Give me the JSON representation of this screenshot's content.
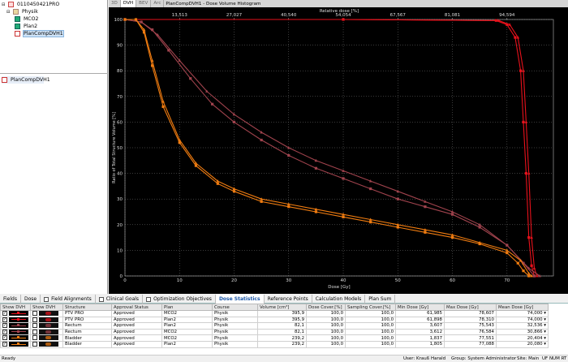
{
  "tree": {
    "patient": "0110450421PRO",
    "course": "Physik",
    "plans": [
      "MCO2",
      "Plan2"
    ],
    "selected": "PlanCompDVH1"
  },
  "plan_list_item": "PlanCompDVH1",
  "chart_tabs": [
    "3D",
    "DVH",
    "BEV",
    "Arc"
  ],
  "chart_title": "PlanCompDVH1 - Dose Volume Histogram",
  "chart_data": {
    "type": "line",
    "title": "",
    "xlabel": "Dose [Gy]",
    "ylabel": "Ratio of Total Structure Volume [%]",
    "x2label": "Relative dose [%]",
    "xlim": [
      0,
      78.5
    ],
    "ylim": [
      0,
      100
    ],
    "xticks": [
      0,
      10,
      20,
      30,
      40,
      50,
      60,
      70
    ],
    "yticks": [
      0,
      10,
      20,
      30,
      40,
      50,
      60,
      70,
      80,
      90,
      100
    ],
    "x2ticks": [
      "13,513",
      "27,027",
      "40,540",
      "54,054",
      "67,567",
      "81,081",
      "94,594"
    ],
    "grid": true,
    "series": [
      {
        "color": "#e8111b",
        "marker": "square",
        "points": [
          [
            0,
            100
          ],
          [
            40,
            100
          ],
          [
            68,
            99.6
          ],
          [
            70,
            98
          ],
          [
            71.5,
            93
          ],
          [
            72.5,
            80
          ],
          [
            73,
            60
          ],
          [
            73.5,
            40
          ],
          [
            74,
            15
          ],
          [
            74.5,
            4
          ],
          [
            75,
            0
          ]
        ]
      },
      {
        "color": "#e8111b",
        "marker": "triangle",
        "points": [
          [
            0,
            100
          ],
          [
            40,
            100
          ],
          [
            68.5,
            99.6
          ],
          [
            70.5,
            98
          ],
          [
            72,
            93
          ],
          [
            73,
            80
          ],
          [
            73.5,
            60
          ],
          [
            74,
            40
          ],
          [
            74.5,
            15
          ],
          [
            75,
            3
          ],
          [
            75.5,
            0
          ]
        ]
      },
      {
        "color": "#a0434d",
        "marker": "square",
        "points": [
          [
            0,
            100
          ],
          [
            3,
            99
          ],
          [
            5,
            96
          ],
          [
            8,
            88
          ],
          [
            12,
            77
          ],
          [
            16,
            67
          ],
          [
            20,
            60
          ],
          [
            25,
            53
          ],
          [
            30,
            47
          ],
          [
            35,
            42
          ],
          [
            40,
            38
          ],
          [
            45,
            34
          ],
          [
            50,
            30
          ],
          [
            55,
            27
          ],
          [
            60,
            24
          ],
          [
            65,
            19
          ],
          [
            70,
            12
          ],
          [
            73,
            5
          ],
          [
            75,
            0
          ]
        ]
      },
      {
        "color": "#a0434d",
        "marker": "triangle",
        "points": [
          [
            0,
            100
          ],
          [
            3,
            99
          ],
          [
            6,
            94
          ],
          [
            10,
            84
          ],
          [
            15,
            72
          ],
          [
            20,
            63
          ],
          [
            25,
            56
          ],
          [
            30,
            50
          ],
          [
            35,
            45
          ],
          [
            40,
            41
          ],
          [
            45,
            37
          ],
          [
            50,
            33
          ],
          [
            55,
            29
          ],
          [
            60,
            25
          ],
          [
            65,
            20
          ],
          [
            70,
            12
          ],
          [
            74,
            3
          ],
          [
            76,
            0
          ]
        ]
      },
      {
        "color": "#f07c10",
        "marker": "square",
        "points": [
          [
            0,
            100
          ],
          [
            2,
            100
          ],
          [
            3.5,
            95
          ],
          [
            5,
            82
          ],
          [
            7,
            66
          ],
          [
            10,
            52
          ],
          [
            13,
            43
          ],
          [
            17,
            36
          ],
          [
            20,
            33
          ],
          [
            25,
            29
          ],
          [
            30,
            27
          ],
          [
            35,
            25
          ],
          [
            40,
            23
          ],
          [
            45,
            21
          ],
          [
            50,
            19
          ],
          [
            55,
            17
          ],
          [
            60,
            15
          ],
          [
            65,
            12.5
          ],
          [
            70,
            9
          ],
          [
            72,
            5
          ],
          [
            73,
            2
          ],
          [
            74,
            0
          ]
        ]
      },
      {
        "color": "#f07c10",
        "marker": "triangle",
        "points": [
          [
            0,
            100
          ],
          [
            2,
            100
          ],
          [
            3.5,
            96
          ],
          [
            5,
            84
          ],
          [
            7,
            68
          ],
          [
            10,
            53
          ],
          [
            13,
            44
          ],
          [
            17,
            37
          ],
          [
            20,
            34
          ],
          [
            25,
            30
          ],
          [
            30,
            28
          ],
          [
            35,
            26
          ],
          [
            40,
            24
          ],
          [
            45,
            22
          ],
          [
            50,
            20
          ],
          [
            55,
            18
          ],
          [
            60,
            16
          ],
          [
            65,
            13
          ],
          [
            70,
            10
          ],
          [
            72.5,
            6
          ],
          [
            74,
            1
          ],
          [
            74.5,
            0
          ]
        ]
      }
    ]
  },
  "bottom_tabs": [
    {
      "label": "Fields",
      "checkbox": false
    },
    {
      "label": "Dose",
      "checkbox": false
    },
    {
      "label": "Field Alignments",
      "checkbox": true
    },
    {
      "label": "Clinical Goals",
      "checkbox": true
    },
    {
      "label": "Optimization Objectives",
      "checkbox": true
    },
    {
      "label": "Dose Statistics",
      "checkbox": false
    },
    {
      "label": "Reference Points",
      "checkbox": false
    },
    {
      "label": "Calculation Models",
      "checkbox": false
    },
    {
      "label": "Plan Sum",
      "checkbox": false
    }
  ],
  "table": {
    "headers": [
      "Show DVH",
      "Show DVH",
      "Structure",
      "Approval Status",
      "Plan",
      "Course",
      "Volume [cm³]",
      "Dose Cover.[%]",
      "Sampling Cover.[%]",
      "Min Dose [Gy]",
      "Max Dose [Gy]",
      "Mean Dose [Gy]"
    ],
    "rows": [
      [
        "PTV PRO",
        "Approved",
        "MCO2",
        "Physik",
        "395,9",
        "100,0",
        "100,0",
        "61,985",
        "78,607",
        "74,000"
      ],
      [
        "PTV PRO",
        "Approved",
        "Plan2",
        "Physik",
        "395,9",
        "100,0",
        "100,0",
        "61,898",
        "78,310",
        "74,000"
      ],
      [
        "Rectum",
        "Approved",
        "Plan2",
        "Physik",
        "82,1",
        "100,0",
        "100,0",
        "3,607",
        "75,543",
        "32,536"
      ],
      [
        "Rectum",
        "Approved",
        "MCO2",
        "Physik",
        "82,1",
        "100,0",
        "100,0",
        "3,612",
        "76,584",
        "30,866"
      ],
      [
        "Bladder",
        "Approved",
        "MCO2",
        "Physik",
        "239,2",
        "100,0",
        "100,0",
        "1,837",
        "77,551",
        "20,404"
      ],
      [
        "Bladder",
        "Approved",
        "Plan2",
        "Physik",
        "239,2",
        "100,0",
        "100,0",
        "1,805",
        "77,088",
        "20,080"
      ]
    ],
    "row_colors": [
      "#e8111b",
      "#e8111b",
      "#a0434d",
      "#a0434d",
      "#f07c10",
      "#f07c10"
    ]
  },
  "status": {
    "left": "Ready",
    "user": "User: Krauß Harald",
    "group": "Group: System Administrator",
    "site": "Site: Main",
    "indicators": "UF  NUM  RT"
  }
}
